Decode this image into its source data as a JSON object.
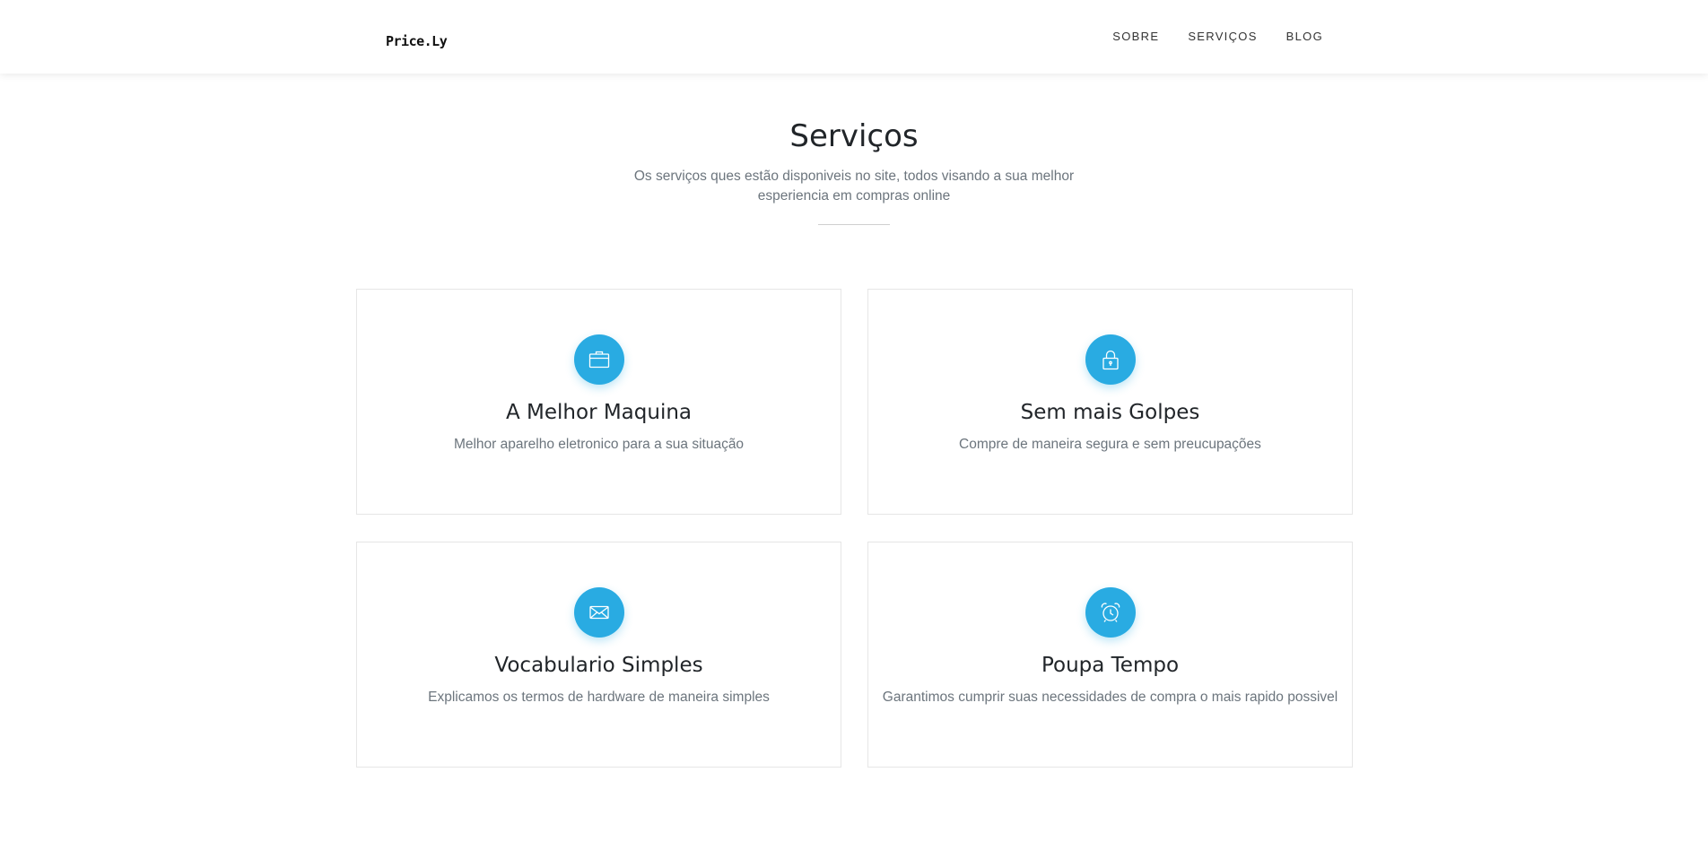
{
  "brand": {
    "logo_text": "Price.Ly"
  },
  "nav": {
    "items": [
      "SOBRE",
      "SERVIÇOS",
      "BLOG"
    ]
  },
  "services": {
    "title": "Serviços",
    "subtitle": "Os serviços ques estão disponiveis no site, todos visando a sua melhor esperiencia em compras online",
    "cards": [
      {
        "icon": "briefcase-icon",
        "title": "A Melhor Maquina",
        "description": "Melhor aparelho eletronico para a sua situação"
      },
      {
        "icon": "lock-icon",
        "title": "Sem mais Golpes",
        "description": "Compre de maneira segura e sem preucupações"
      },
      {
        "icon": "envelope-icon",
        "title": "Vocabulario Simples",
        "description": "Explicamos os termos de hardware de maneira simples"
      },
      {
        "icon": "alarm-clock-icon",
        "title": "Poupa Tempo",
        "description": "Garantimos cumprir suas necessidades de compra o mais rapido possivel"
      }
    ]
  },
  "colors": {
    "accent": "#29abe2",
    "text_dark": "#212529",
    "text_muted": "#6c757d"
  }
}
